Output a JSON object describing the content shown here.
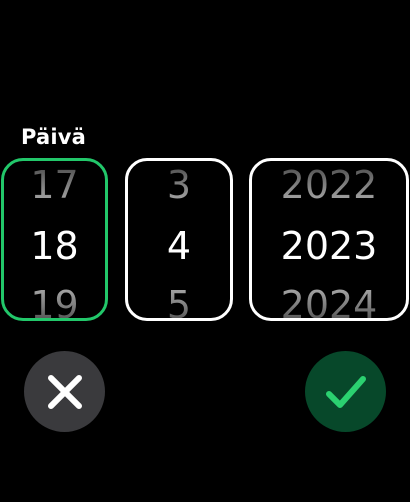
{
  "picker": {
    "label": "Päivä",
    "columns": {
      "day": {
        "prev": "17",
        "current": "18",
        "next": "19",
        "focused": true
      },
      "month": {
        "prev": "3",
        "current": "4",
        "next": "5",
        "focused": false
      },
      "year": {
        "prev": "2022",
        "current": "2023",
        "next": "2024",
        "focused": false
      }
    }
  },
  "actions": {
    "cancel": {
      "icon": "close-icon",
      "color": "#3a3a3d",
      "icon_color": "#ffffff"
    },
    "confirm": {
      "icon": "checkmark-icon",
      "color": "#07482a",
      "icon_color": "#2bd170"
    }
  },
  "colors": {
    "background": "#000000",
    "focus_border": "#22c76a",
    "wheel_border": "#ffffff"
  }
}
